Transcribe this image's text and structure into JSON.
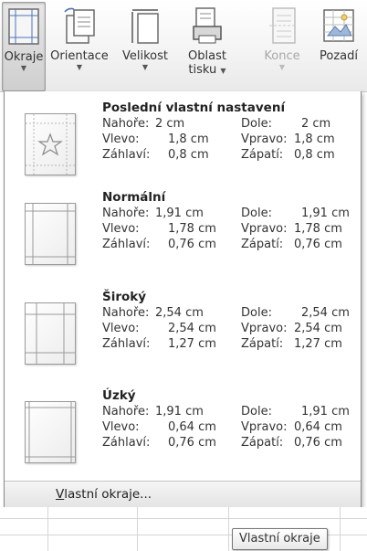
{
  "ribbon": {
    "buttons": [
      {
        "label": "Okraje",
        "second_line": "",
        "icon": "margins-icon",
        "state": "active"
      },
      {
        "label": "Orientace",
        "second_line": "",
        "icon": "orientation-icon",
        "state": "normal"
      },
      {
        "label": "Velikost",
        "second_line": "",
        "icon": "size-icon",
        "state": "normal"
      },
      {
        "label": "Oblast",
        "second_line": "tisku",
        "icon": "print-area-icon",
        "state": "normal"
      },
      {
        "label": "Konce",
        "second_line": "",
        "icon": "breaks-icon",
        "state": "disabled"
      },
      {
        "label": "Pozadí",
        "second_line": "",
        "icon": "background-icon",
        "state": "normal"
      }
    ]
  },
  "presets": [
    {
      "title": "Poslední vlastní nastavení",
      "icon": "star-icon",
      "top_label": "Nahoře:",
      "top_value": "2 cm",
      "bottom_label": "Dole:",
      "bottom_value": "2 cm",
      "left_label": "Vlevo:",
      "left_value": "1,8 cm",
      "right_label": "Vpravo:",
      "right_value": "1,8 cm",
      "header_label": "Záhlaví:",
      "header_value": "0,8 cm",
      "footer_label": "Zápatí:",
      "footer_value": "0,8 cm"
    },
    {
      "title": "Normální",
      "icon": "normal-margins-icon",
      "top_label": "Nahoře:",
      "top_value": "1,91 cm",
      "bottom_label": "Dole:",
      "bottom_value": "1,91 cm",
      "left_label": "Vlevo:",
      "left_value": "1,78 cm",
      "right_label": "Vpravo:",
      "right_value": "1,78 cm",
      "header_label": "Záhlaví:",
      "header_value": "0,76 cm",
      "footer_label": "Zápatí:",
      "footer_value": "0,76 cm"
    },
    {
      "title": "Široký",
      "icon": "wide-margins-icon",
      "top_label": "Nahoře:",
      "top_value": "2,54 cm",
      "bottom_label": "Dole:",
      "bottom_value": "2,54 cm",
      "left_label": "Vlevo:",
      "left_value": "2,54 cm",
      "right_label": "Vpravo:",
      "right_value": "2,54 cm",
      "header_label": "Záhlaví:",
      "header_value": "1,27 cm",
      "footer_label": "Zápatí:",
      "footer_value": "1,27 cm"
    },
    {
      "title": "Úzký",
      "icon": "narrow-margins-icon",
      "top_label": "Nahoře:",
      "top_value": "1,91 cm",
      "bottom_label": "Dole:",
      "bottom_value": "1,91 cm",
      "left_label": "Vlevo:",
      "left_value": "0,64 cm",
      "right_label": "Vpravo:",
      "right_value": "0,64 cm",
      "header_label": "Záhlaví:",
      "header_value": "0,76 cm",
      "footer_label": "Zápatí:",
      "footer_value": "0,76 cm"
    }
  ],
  "footer": {
    "accelerator": "V",
    "label_rest": "lastní okraje..."
  },
  "tooltip": {
    "text": "Vlastní okraje"
  }
}
